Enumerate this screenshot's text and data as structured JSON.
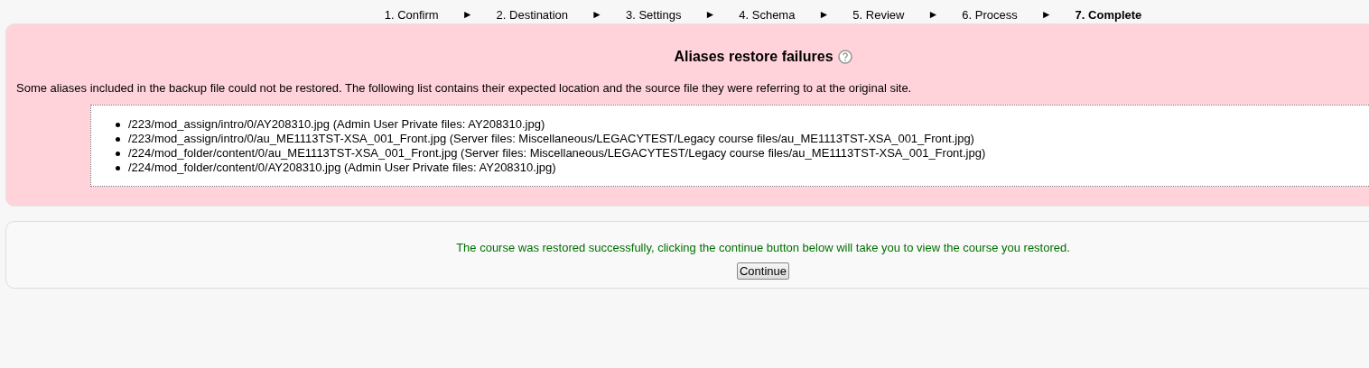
{
  "steps": [
    {
      "kind": "step",
      "label": "1. Confirm",
      "selected": false
    },
    {
      "kind": "separator",
      "label": "►"
    },
    {
      "kind": "step",
      "label": "2. Destination",
      "selected": false
    },
    {
      "kind": "separator",
      "label": "►"
    },
    {
      "kind": "step",
      "label": "3. Settings",
      "selected": false
    },
    {
      "kind": "separator",
      "label": "►"
    },
    {
      "kind": "step",
      "label": "4. Schema",
      "selected": false
    },
    {
      "kind": "separator",
      "label": "►"
    },
    {
      "kind": "step",
      "label": "5. Review",
      "selected": false
    },
    {
      "kind": "separator",
      "label": "►"
    },
    {
      "kind": "step",
      "label": "6. Process",
      "selected": false
    },
    {
      "kind": "separator",
      "label": "►"
    },
    {
      "kind": "step",
      "label": "7. Complete",
      "selected": true
    }
  ],
  "failures": {
    "title": "Aliases restore failures",
    "message": "Some aliases included in the backup file could not be restored. The following list contains their expected location and the source file they were referring to at the original site.",
    "items": [
      "/223/mod_assign/intro/0/AY208310.jpg (Admin User Private files: AY208310.jpg)",
      "/223/mod_assign/intro/0/au_ME1113TST-XSA_001_Front.jpg (Server files: Miscellaneous/LEGACYTEST/Legacy course files/au_ME1113TST-XSA_001_Front.jpg)",
      "/224/mod_folder/content/0/au_ME1113TST-XSA_001_Front.jpg (Server files: Miscellaneous/LEGACYTEST/Legacy course files/au_ME1113TST-XSA_001_Front.jpg)",
      "/224/mod_folder/content/0/AY208310.jpg (Admin User Private files: AY208310.jpg)"
    ]
  },
  "success": {
    "message": "The course was restored successfully, clicking the continue button below will take you to view the course you restored.",
    "button": "Continue"
  }
}
